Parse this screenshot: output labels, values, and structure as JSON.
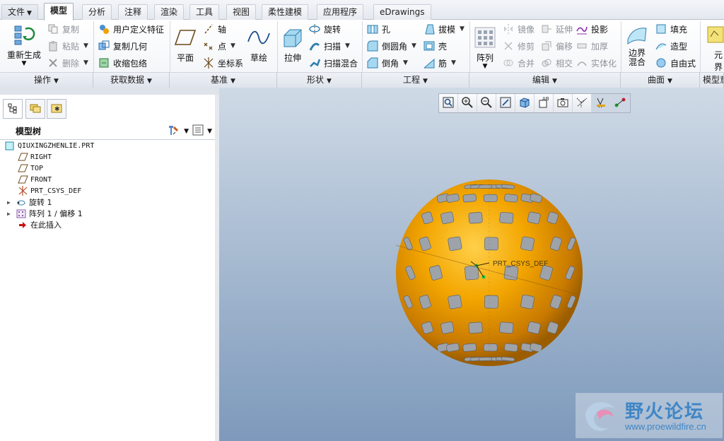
{
  "menu": {
    "file": "文件",
    "tabs": [
      "模型",
      "分析",
      "注释",
      "渲染",
      "工具",
      "视图",
      "柔性建模",
      "应用程序",
      "eDrawings"
    ]
  },
  "ribbon": {
    "groups": [
      "操作",
      "获取数据",
      "基准",
      "形状",
      "工程",
      "编辑",
      "曲面",
      "模型意"
    ],
    "operations": {
      "regenerate": "重新生成",
      "copy": "复制",
      "paste": "粘贴",
      "delete": "删除"
    },
    "get_data": {
      "udf": "用户定义特征",
      "copy_geom": "复制几何",
      "shrinkwrap": "收缩包络"
    },
    "datum": {
      "plane": "平面",
      "axis": "轴",
      "point": "点",
      "csys": "坐标系",
      "sketch": "草绘"
    },
    "shapes": {
      "extrude": "拉伸",
      "revolve": "旋转",
      "sweep": "扫描",
      "swept_blend": "扫描混合"
    },
    "engineering": {
      "hole": "孔",
      "round": "倒圆角",
      "chamfer": "倒角",
      "draft": "拔模",
      "shell": "壳",
      "rib": "筋"
    },
    "editing": {
      "pattern": "阵列",
      "mirror": "镜像",
      "trim": "修剪",
      "merge": "合并",
      "extend": "延伸",
      "offset": "偏移",
      "intersect": "相交",
      "project": "投影",
      "thicken": "加厚",
      "solidify": "实体化"
    },
    "surfaces": {
      "boundary_blend_1": "边界",
      "boundary_blend_2": "混合",
      "fill": "填充",
      "style": "造型",
      "freestyle": "自由式"
    },
    "more": "元界"
  },
  "model_tree": {
    "title": "模型树",
    "items": [
      {
        "label": "QIUXINGZHENLIE.PRT"
      },
      {
        "label": "RIGHT"
      },
      {
        "label": "TOP"
      },
      {
        "label": "FRONT"
      },
      {
        "label": "PRT_CSYS_DEF"
      },
      {
        "label": "旋转 1"
      },
      {
        "label": "阵列 1 / 偏移 1"
      },
      {
        "label": "在此插入"
      }
    ]
  },
  "viewport": {
    "csys_label": "PRT_CSYS_DEF"
  },
  "watermark": {
    "text": "野火论坛",
    "url": "www.proewildfire.cn"
  },
  "colors": {
    "sphere": "#f0a000",
    "accent": "#3f86c6",
    "viewport_top": "#cfdae6",
    "viewport_bottom": "#7d99bb"
  }
}
